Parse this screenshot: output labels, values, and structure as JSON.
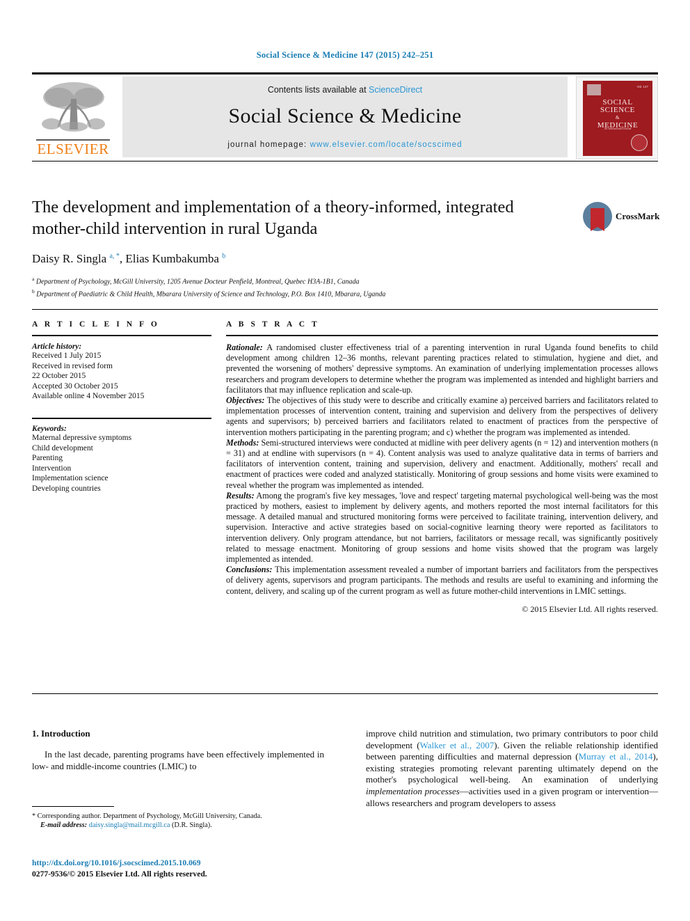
{
  "running_head": "Social Science & Medicine 147 (2015) 242–251",
  "masthead": {
    "contents_prefix": "Contents lists available at ",
    "sciencedirect_link": "ScienceDirect",
    "journal_title": "Social Science & Medicine",
    "homepage_prefix": "journal homepage: ",
    "homepage_link": "www.elsevier.com/locate/socscimed",
    "publisher_name": "ELSEVIER",
    "publisher_color": "#ef7d15",
    "link_color": "#2a96d3",
    "band_color": "#e6e6e6",
    "cover": {
      "issue_label": "Vol. 147",
      "title_line1": "SOCIAL",
      "title_line2": "SCIENCE",
      "title_amp": "&",
      "title_line3": "MEDICINE",
      "subtitle": "An International Journal",
      "color": "#9e1b20"
    }
  },
  "article": {
    "title": "The development and implementation of a theory-informed, integrated mother-child intervention in rural Uganda",
    "authors_html": "Daisy R. Singla <sup>a, *</sup>, Elias Kumbakumba <sup>b</sup>",
    "affiliation_a": "Department of Psychology, McGill University, 1205 Avenue Docteur Penfield, Montreal, Quebec H3A-1B1, Canada",
    "affiliation_b": "Department of Paediatric & Child Health, Mbarara University of Science and Technology, P.O. Box 1410, Mbarara, Uganda",
    "crossmark_label": "CrossMark"
  },
  "article_info": {
    "heading": "A R T I C L E   I N F O",
    "history_label": "Article history:",
    "history_lines": [
      "Received 1 July 2015",
      "Received in revised form",
      "22 October 2015",
      "Accepted 30 October 2015",
      "Available online 4 November 2015"
    ],
    "keywords_label": "Keywords:",
    "keywords": [
      "Maternal depressive symptoms",
      "Child development",
      "Parenting",
      "Intervention",
      "Implementation science",
      "Developing countries"
    ]
  },
  "abstract": {
    "heading": "A B S T R A C T",
    "sections": [
      {
        "label": "Rationale:",
        "text": " A randomised cluster effectiveness trial of a parenting intervention in rural Uganda found benefits to child development among children 12–36 months, relevant parenting practices related to stimulation, hygiene and diet, and prevented the worsening of mothers' depressive symptoms. An examination of underlying implementation processes allows researchers and program developers to determine whether the program was implemented as intended and highlight barriers and facilitators that may influence replication and scale-up."
      },
      {
        "label": "Objectives:",
        "text": " The objectives of this study were to describe and critically examine a) perceived barriers and facilitators related to implementation processes of intervention content, training and supervision and delivery from the perspectives of delivery agents and supervisors; b) perceived barriers and facilitators related to enactment of practices from the perspective of intervention mothers participating in the parenting program; and c) whether the program was implemented as intended."
      },
      {
        "label": "Methods:",
        "text": " Semi-structured interviews were conducted at midline with peer delivery agents (n = 12) and intervention mothers (n = 31) and at endline with supervisors (n = 4). Content analysis was used to analyze qualitative data in terms of barriers and facilitators of intervention content, training and supervision, delivery and enactment. Additionally, mothers' recall and enactment of practices were coded and analyzed statistically. Monitoring of group sessions and home visits were examined to reveal whether the program was implemented as intended."
      },
      {
        "label": "Results:",
        "text": " Among the program's five key messages, 'love and respect' targeting maternal psychological well-being was the most practiced by mothers, easiest to implement by delivery agents, and mothers reported the most internal facilitators for this message. A detailed manual and structured monitoring forms were perceived to facilitate training, intervention delivery, and supervision. Interactive and active strategies based on social-cognitive learning theory were reported as facilitators to intervention delivery. Only program attendance, but not barriers, facilitators or message recall, was significantly positively related to message enactment. Monitoring of group sessions and home visits showed that the program was largely implemented as intended."
      },
      {
        "label": "Conclusions:",
        "text": " This implementation assessment revealed a number of important barriers and facilitators from the perspectives of delivery agents, supervisors and program participants. The methods and results are useful to examining and informing the content, delivery, and scaling up of the current program as well as future mother-child interventions in LMIC settings."
      }
    ],
    "copyright": "© 2015 Elsevier Ltd. All rights reserved."
  },
  "body": {
    "intro_heading": "1. Introduction",
    "left_para_html": "In the last decade, parenting programs have been effectively implemented in low- and middle-income countries (LMIC) to",
    "right_para_html": "improve child nutrition and stimulation, two primary contributors to poor child development (<span class=\"ref-link\">Walker et al., 2007</span>). Given the reliable relationship identified between parenting difficulties and maternal depression (<span class=\"ref-link\">Murray et al., 2014</span>), existing strategies promoting relevant parenting ultimately depend on the mother's psychological well-being. An examination of underlying <span class=\"ital\">implementation processes</span>—activities used in a given program or intervention—allows researchers and program developers to assess"
  },
  "footnote": {
    "corresponding_html": "<span class=\"star\">*</span> Corresponding author. Department of Psychology, McGill University, Canada.",
    "email_label": "E-mail address:",
    "email": "daisy.singla@mail.mcgill.ca",
    "email_owner": "(D.R. Singla)."
  },
  "doi": {
    "url": "http://dx.doi.org/10.1016/j.socscimed.2015.10.069",
    "issn_line": "0277-9536/© 2015 Elsevier Ltd. All rights reserved."
  }
}
